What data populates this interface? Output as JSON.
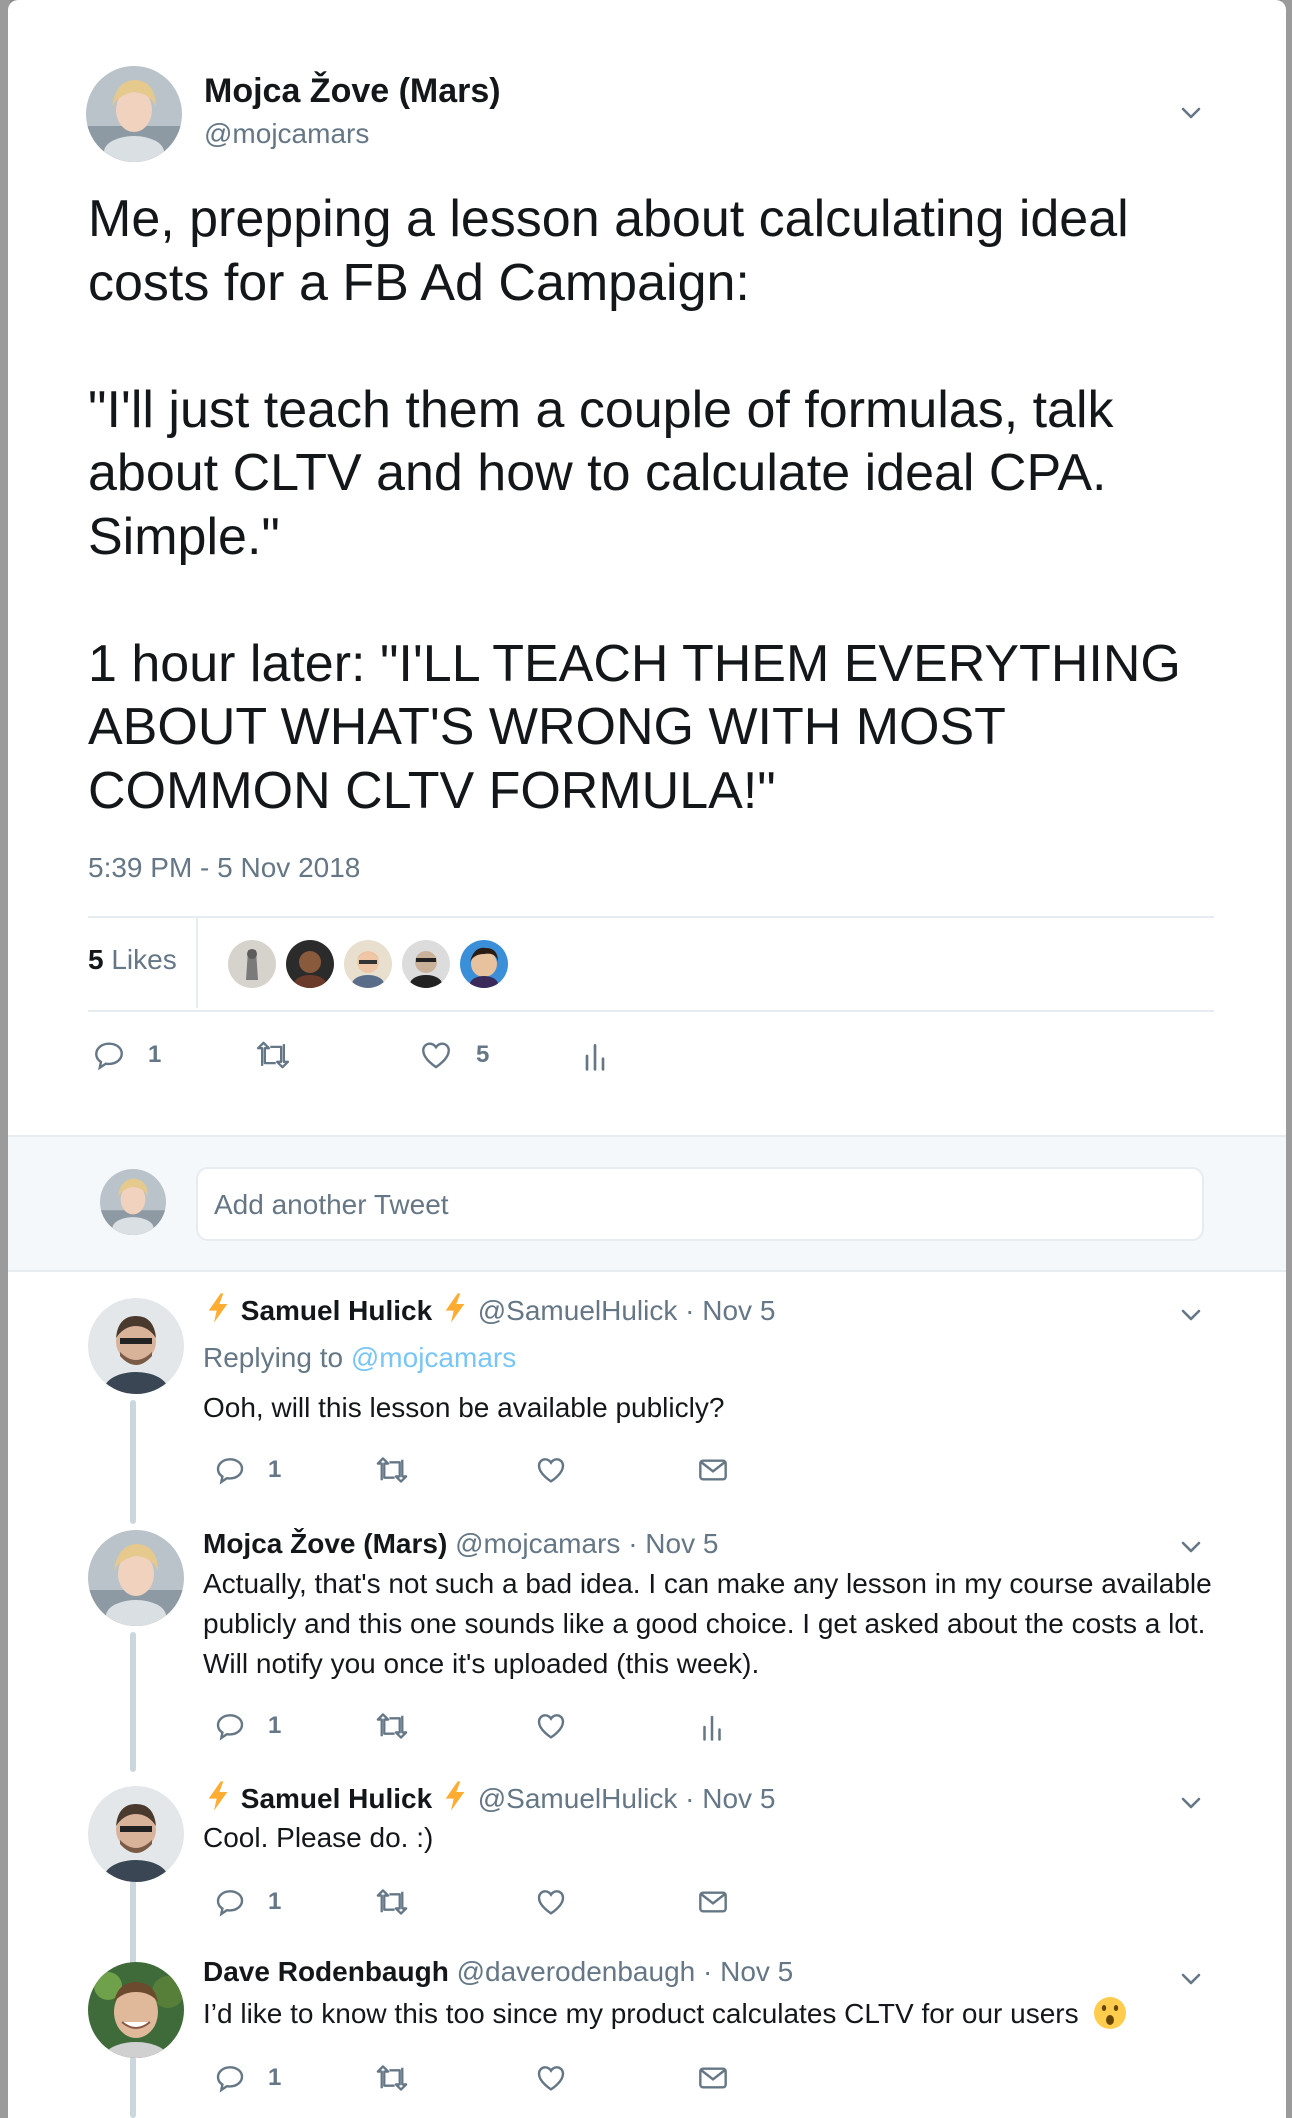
{
  "tweet": {
    "author_name": "Mojca Žove (Mars)",
    "author_handle": "@mojcamars",
    "text": "Me, prepping a lesson about calculating ideal costs for a FB Ad Campaign:\n\n\"I'll just teach them a couple of formulas, talk about CLTV and how to calculate ideal CPA. Simple.\"\n\n1 hour later: \"I'LL TEACH THEM EVERYTHING ABOUT WHAT'S WRONG WITH MOST COMMON CLTV FORMULA!\"",
    "timestamp": "5:39 PM - 5 Nov 2018",
    "likes_number": "5",
    "likes_label": "Likes",
    "reply_count": "1",
    "retweet_count": "",
    "like_count": "5"
  },
  "compose": {
    "placeholder": "Add another Tweet"
  },
  "replies": [
    {
      "name": "Samuel Hulick",
      "handle": "@SamuelHulick",
      "date": "· Nov 5",
      "replying_prefix": "Replying to",
      "replying_to": "@mojcamars",
      "text": "Ooh, will this lesson be available publicly?",
      "reply_count": "1"
    },
    {
      "name": "Mojca Žove (Mars)",
      "handle": "@mojcamars",
      "date": "· Nov 5",
      "text": "Actually, that's not such a bad idea. I can make any lesson in my course available publicly and this one sounds like a good choice. I get asked about the costs a lot. Will notify you once it's uploaded (this week).",
      "reply_count": "1"
    },
    {
      "name": "Samuel Hulick",
      "handle": "@SamuelHulick",
      "date": "· Nov 5",
      "text": "Cool. Please do.  :)",
      "reply_count": "1"
    },
    {
      "name": "Dave Rodenbaugh",
      "handle": "@daverodenbaugh",
      "date": "· Nov 5",
      "text": "I’d like to know this too since my product calculates CLTV for our users",
      "reply_count": "1"
    }
  ],
  "icons": {
    "reply": "reply-icon",
    "retweet": "retweet-icon",
    "like": "heart-icon",
    "analytics": "analytics-icon",
    "dm": "envelope-icon",
    "more": "chevron-down-icon",
    "bolt": "lightning-bolt-icon",
    "emoji": "surprised-face-emoji"
  },
  "colors": {
    "muted": "#657786",
    "link": "#1da1f2",
    "divider": "#e6ecf0",
    "bolt": "#ffac33"
  }
}
